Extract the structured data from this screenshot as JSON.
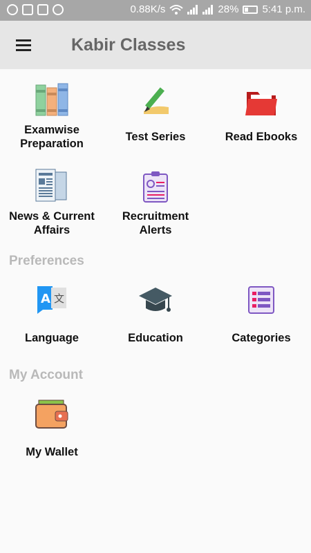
{
  "status_bar": {
    "speed": "0.88K/s",
    "battery": "28%",
    "time": "5:41 p.m."
  },
  "app_bar": {
    "title": "Kabir Classes",
    "menu_icon": "hamburger-menu-icon"
  },
  "tiles": [
    {
      "label": "Examwise\nPreparation",
      "icon": "books-icon"
    },
    {
      "label": "Test Series",
      "icon": "pencil-writing-icon"
    },
    {
      "label": "Read Ebooks",
      "icon": "red-folder-icon"
    },
    {
      "label": "News & Current\nAffairs",
      "icon": "newspaper-icon"
    },
    {
      "label": "Recruitment\nAlerts",
      "icon": "id-clipboard-icon"
    }
  ],
  "preferences": {
    "header": "Preferences",
    "items": [
      {
        "label": "Language",
        "icon": "translate-icon"
      },
      {
        "label": "Education",
        "icon": "graduation-cap-icon"
      },
      {
        "label": "Categories",
        "icon": "list-icon"
      }
    ]
  },
  "account": {
    "header": "My Account",
    "items": [
      {
        "label": "My Wallet",
        "icon": "wallet-icon"
      }
    ]
  }
}
